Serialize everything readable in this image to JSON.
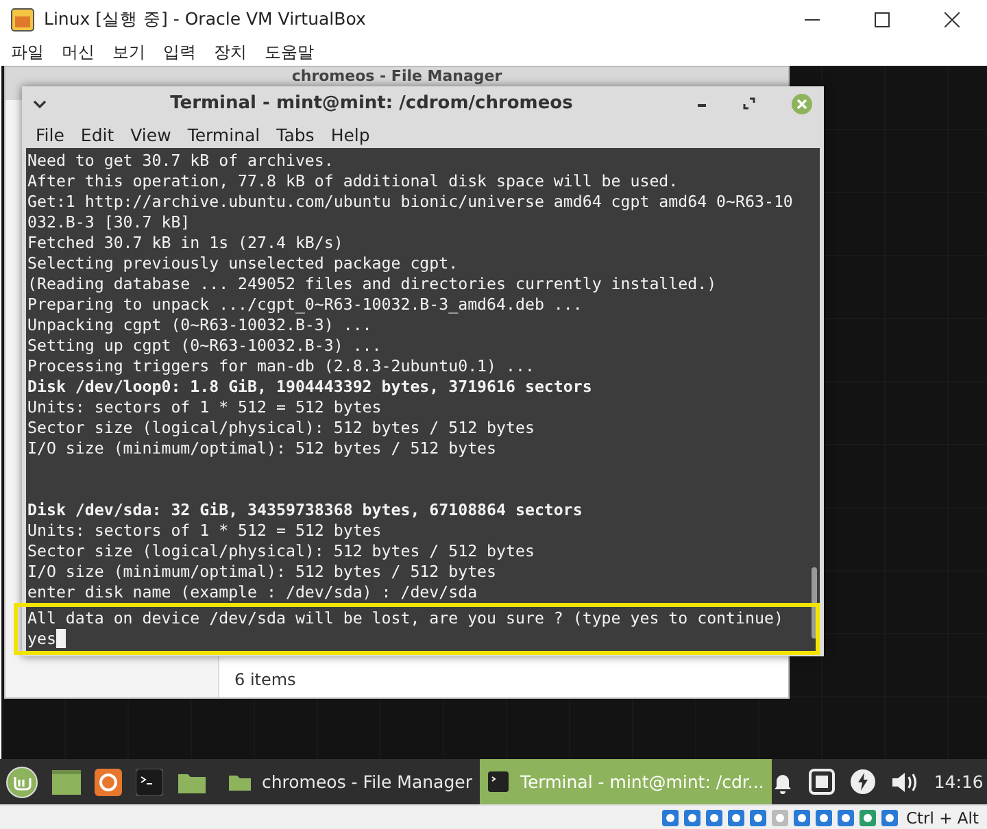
{
  "window": {
    "title": "Linux [실행 중] - Oracle VM VirtualBox"
  },
  "menu": [
    "파일",
    "머신",
    "보기",
    "입력",
    "장치",
    "도움말"
  ],
  "file_manager": {
    "title": "chromeos - File Manager",
    "status": "6 items"
  },
  "terminal": {
    "title": "Terminal - mint@mint: /cdrom/chromeos",
    "menu": [
      "File",
      "Edit",
      "View",
      "Terminal",
      "Tabs",
      "Help"
    ],
    "lines": [
      {
        "kind": "text",
        "text": "Need to get 30.7 kB of archives."
      },
      {
        "kind": "text",
        "text": "After this operation, 77.8 kB of additional disk space will be used."
      },
      {
        "kind": "text",
        "text": "Get:1 http://archive.ubuntu.com/ubuntu bionic/universe amd64 cgpt amd64 0~R63-10"
      },
      {
        "kind": "text",
        "text": "032.B-3 [30.7 kB]"
      },
      {
        "kind": "text",
        "text": "Fetched 30.7 kB in 1s (27.4 kB/s)"
      },
      {
        "kind": "text",
        "text": "Selecting previously unselected package cgpt."
      },
      {
        "kind": "text",
        "text": "(Reading database ... 249052 files and directories currently installed.)"
      },
      {
        "kind": "text",
        "text": "Preparing to unpack .../cgpt_0~R63-10032.B-3_amd64.deb ..."
      },
      {
        "kind": "text",
        "text": "Unpacking cgpt (0~R63-10032.B-3) ..."
      },
      {
        "kind": "text",
        "text": "Setting up cgpt (0~R63-10032.B-3) ..."
      },
      {
        "kind": "text",
        "text": "Processing triggers for man-db (2.8.3-2ubuntu0.1) ..."
      },
      {
        "kind": "bold",
        "text": "Disk /dev/loop0: 1.8 GiB, 1904443392 bytes, 3719616 sectors"
      },
      {
        "kind": "text",
        "text": "Units: sectors of 1 * 512 = 512 bytes"
      },
      {
        "kind": "text",
        "text": "Sector size (logical/physical): 512 bytes / 512 bytes"
      },
      {
        "kind": "text",
        "text": "I/O size (minimum/optimal): 512 bytes / 512 bytes"
      },
      {
        "kind": "blank"
      },
      {
        "kind": "blank"
      },
      {
        "kind": "bold",
        "text": "Disk /dev/sda: 32 GiB, 34359738368 bytes, 67108864 sectors"
      },
      {
        "kind": "text",
        "text": "Units: sectors of 1 * 512 = 512 bytes"
      },
      {
        "kind": "text",
        "text": "Sector size (logical/physical): 512 bytes / 512 bytes"
      },
      {
        "kind": "text",
        "text": "I/O size (minimum/optimal): 512 bytes / 512 bytes"
      },
      {
        "kind": "text",
        "text": "enter disk name (example : /dev/sda) : /dev/sda"
      },
      {
        "kind": "text",
        "text": "All data on device /dev/sda will be lost, are you sure ? (type yes to continue)"
      },
      {
        "kind": "input",
        "text": "yes"
      }
    ]
  },
  "taskbar": {
    "tasks": [
      {
        "label": "chromeos - File Manager",
        "selected": false
      },
      {
        "label": "Terminal - mint@mint: /cdr...",
        "selected": true
      }
    ],
    "clock": "14:16"
  },
  "status_bar": {
    "host_key": "Ctrl + Alt"
  }
}
